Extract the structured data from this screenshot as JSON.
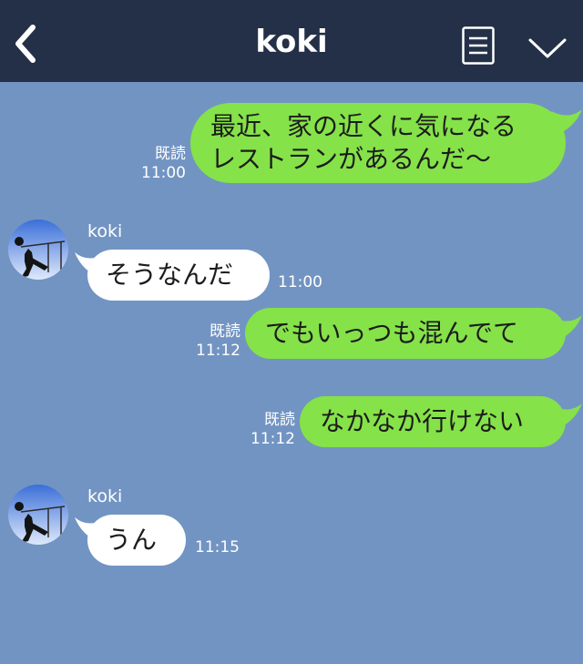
{
  "header": {
    "title": "koki",
    "back_icon": "chevron-left-icon",
    "menu_icon": "menu-icon",
    "collapse_icon": "chevron-down-icon",
    "bg_color": "#243048"
  },
  "colors": {
    "chat_bg": "#7294c2",
    "sent_bubble": "#85e249",
    "received_bubble": "#ffffff"
  },
  "messages": [
    {
      "direction": "sent",
      "lines": [
        "最近、家の近くに気になる",
        "レストランがあるんだ〜"
      ],
      "read_label": "既読",
      "time": "11:00"
    },
    {
      "direction": "received",
      "sender": "koki",
      "text": "そうなんだ",
      "time": "11:00"
    },
    {
      "direction": "sent",
      "text": "でもいっつも混んでて",
      "read_label": "既読",
      "time": "11:12"
    },
    {
      "direction": "sent",
      "text": "なかなか行けない",
      "read_label": "既読",
      "time": "11:12"
    },
    {
      "direction": "received",
      "sender": "koki",
      "text": "うん",
      "time": "11:15"
    }
  ]
}
